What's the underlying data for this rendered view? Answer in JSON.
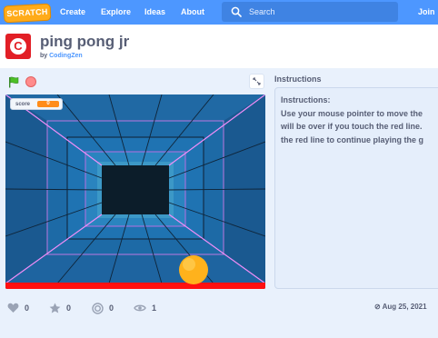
{
  "nav": {
    "logo": "SCRATCH",
    "create": "Create",
    "explore": "Explore",
    "ideas": "Ideas",
    "about": "About",
    "search_placeholder": "Search",
    "join": "Join S"
  },
  "project": {
    "title": "ping pong jr",
    "by": "by",
    "author": "CodingZen"
  },
  "stage": {
    "monitor_label": "score",
    "monitor_value": "0"
  },
  "instructions": {
    "heading": "Instructions",
    "lines": [
      "Instructions:",
      "Use your mouse pointer to move the",
      "will be over if you touch the red line.",
      "the red line to continue playing the g"
    ]
  },
  "stats": {
    "loves": "0",
    "favorites": "0",
    "remixes": "0",
    "views": "1",
    "date": "Aug 25, 2021"
  },
  "colors": {
    "brand_blue": "#4d97ff",
    "scratch_orange": "#ffab19",
    "neon_pink": "#e57cf0",
    "red_line": "#ff1010",
    "ball": "#ffb21c"
  }
}
